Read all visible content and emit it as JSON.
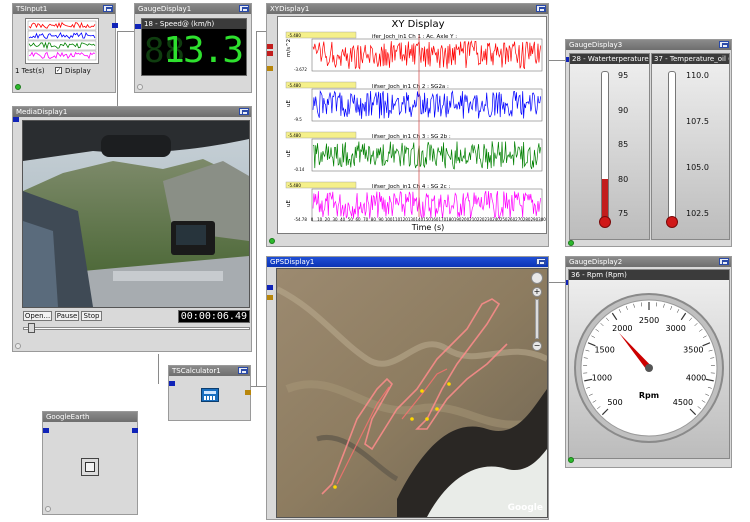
{
  "panels": {
    "tsinput": {
      "title": "TSInput1",
      "tests": "1 Test(s)",
      "display_label": "Display",
      "display_checked": true
    },
    "speed": {
      "title": "GaugeDisplay1",
      "channel": "18 - Speed@ (km/h)",
      "value": "13.3",
      "digits_left": "88"
    },
    "xy": {
      "title": "XYDisplay1",
      "chart_title": "XY Display",
      "strips": [
        {
          "label": "ifer_Joch_in1  Ch 1 : Ac. Axle Y :",
          "unit": "m/s^2",
          "ymin": "-3.672",
          "ymax": "-5.480",
          "color": "#ff0000"
        },
        {
          "label": "lifser_Joch_in1  Ch 2 : SG2a :",
          "unit": "uE",
          "ymin": "-9.5",
          "ymax": "-5.480",
          "color": "#0000ff"
        },
        {
          "label": "lifser_Joch_in1  Ch 3 : SG 2b :",
          "unit": "uE",
          "ymin": "-0.14",
          "ymax": "-5.480",
          "color": "#008000"
        },
        {
          "label": "lifser_Joch_in1  Ch 4 : SG 2c :",
          "unit": "uE",
          "ymin": "-54.78",
          "ymax": "-5.480",
          "color": "#ff00ff"
        }
      ],
      "xlabel": "Time (s)",
      "xticks": [
        "0",
        "10",
        "20",
        "30",
        "40",
        "50",
        "60",
        "70",
        "80",
        "90",
        "100",
        "110",
        "120",
        "130",
        "140",
        "150",
        "160",
        "170",
        "180",
        "190",
        "200",
        "210",
        "220",
        "230",
        "240",
        "250",
        "260",
        "270",
        "280",
        "290",
        "300"
      ]
    },
    "gauge3": {
      "title": "GaugeDisplay3",
      "left": {
        "channel": "28 - Waterterperature (°C)",
        "ticks": [
          "95",
          "90",
          "85",
          "80",
          "75"
        ],
        "level": 0.28
      },
      "right": {
        "channel": "37 - Temperature_oil (C)",
        "ticks": [
          "110.0",
          "107.5",
          "105.0",
          "102.5"
        ],
        "level": 0.02
      }
    },
    "media": {
      "title": "MediaDisplay1",
      "open": "Open...",
      "pause": "Pause",
      "stop": "Stop",
      "time": "00:00:06.49",
      "progress": 0.02
    },
    "gps": {
      "title": "GPSDisplay1",
      "google": "Google"
    },
    "rpm": {
      "title": "GaugeDisplay2",
      "channel": "36 - Rpm (Rpm)",
      "unit": "Rpm",
      "min": 500,
      "max": 4500,
      "value": 1900,
      "ticks": [
        "500",
        "1000",
        "1500",
        "2000",
        "2500",
        "3000",
        "3500",
        "4000",
        "4500"
      ]
    },
    "calc": {
      "title": "TSCalculator1"
    },
    "earth": {
      "title": "GoogleEarth"
    }
  },
  "colors": {
    "panel": "#d9d9d9",
    "title_inactive": "#7a7a7a",
    "title_active": "#0b33b5",
    "port": "#1023b8",
    "needle": "#cc0000",
    "lcd": "#2ee02e"
  }
}
